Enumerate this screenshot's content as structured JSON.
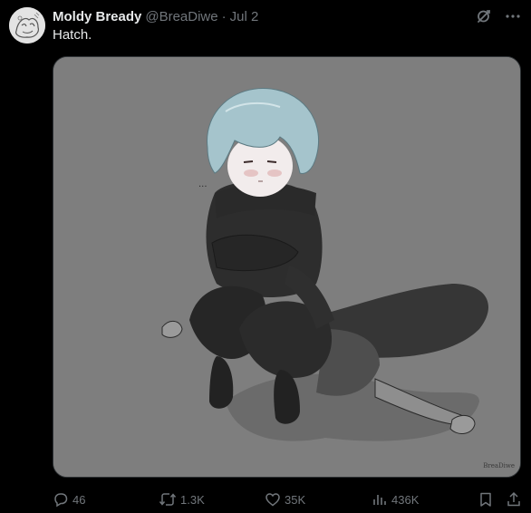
{
  "tweet": {
    "author": {
      "display_name": "Moldy Bready",
      "handle": "@BreaDiwe",
      "separator": "·",
      "date": "Jul 2"
    },
    "text": "Hatch.",
    "media": {
      "signature": "BreaDiwe",
      "ellipsis": "..."
    },
    "actions": {
      "replies": "46",
      "reposts": "1.3K",
      "likes": "35K",
      "views": "436K"
    },
    "icons": {
      "grok": "grok-icon",
      "more": "more-icon",
      "reply": "reply-icon",
      "repost": "repost-icon",
      "like": "like-icon",
      "views": "views-icon",
      "bookmark": "bookmark-icon",
      "share": "share-icon"
    },
    "colors": {
      "background": "#000000",
      "text": "#e7e9ea",
      "muted": "#71767b",
      "media_background": "#7e7e7e"
    }
  }
}
